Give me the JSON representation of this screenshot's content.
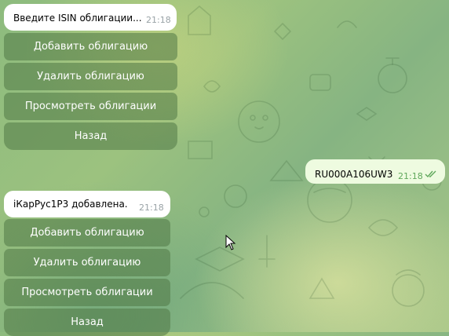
{
  "messages": [
    {
      "text": "Введите ISIN облигации...",
      "time": "21:18"
    },
    {
      "text": "RU000A106UW3",
      "time": "21:18"
    },
    {
      "text": "iКарРус1P3 добавлена.",
      "time": "21:18"
    }
  ],
  "keyboard_top": {
    "buttons": [
      "Добавить облигацию",
      "Удалить облигацию",
      "Просмотреть облигации",
      "Назад"
    ]
  },
  "keyboard_bottom": {
    "buttons": [
      "Добавить облигацию",
      "Удалить облигацию",
      "Просмотреть облигации",
      "Назад"
    ]
  },
  "icons": {
    "read_status": "double-check-icon",
    "pointer": "mouse-pointer-icon"
  },
  "colors": {
    "incoming_bubble": "#ffffff",
    "outgoing_bubble": "#eefbe0",
    "time_incoming": "#9aa3a7",
    "time_outgoing": "#5fa85b",
    "keyboard_button": "#6f8f5a"
  }
}
